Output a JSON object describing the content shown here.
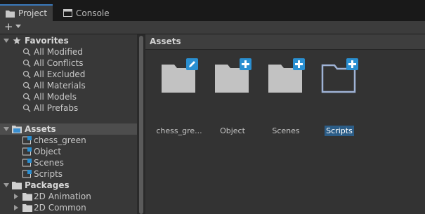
{
  "tabs": [
    {
      "label": "Project",
      "icon": "folder-icon",
      "active": true
    },
    {
      "label": "Console",
      "icon": "console-icon",
      "active": false
    }
  ],
  "toolbar": {
    "add_label": "+"
  },
  "tree": {
    "favorites": {
      "label": "Favorites",
      "items": [
        "All Modified",
        "All Conflicts",
        "All Excluded",
        "All Materials",
        "All Models",
        "All Prefabs"
      ]
    },
    "assets": {
      "label": "Assets",
      "items": [
        "chess_green",
        "Object",
        "Scenes",
        "Scripts"
      ]
    },
    "packages": {
      "label": "Packages",
      "items": [
        "2D Animation",
        "2D Common"
      ]
    }
  },
  "breadcrumb": "Assets",
  "grid": [
    {
      "label": "chess_gre...",
      "badge": "edit",
      "selected": false
    },
    {
      "label": "Object",
      "badge": "plus",
      "selected": false
    },
    {
      "label": "Scenes",
      "badge": "plus",
      "selected": false
    },
    {
      "label": "Scripts",
      "badge": "plus",
      "selected": true
    }
  ],
  "colors": {
    "accent": "#3a79bb",
    "badge": "#2a8fd1",
    "selection": "#2c5d87"
  }
}
